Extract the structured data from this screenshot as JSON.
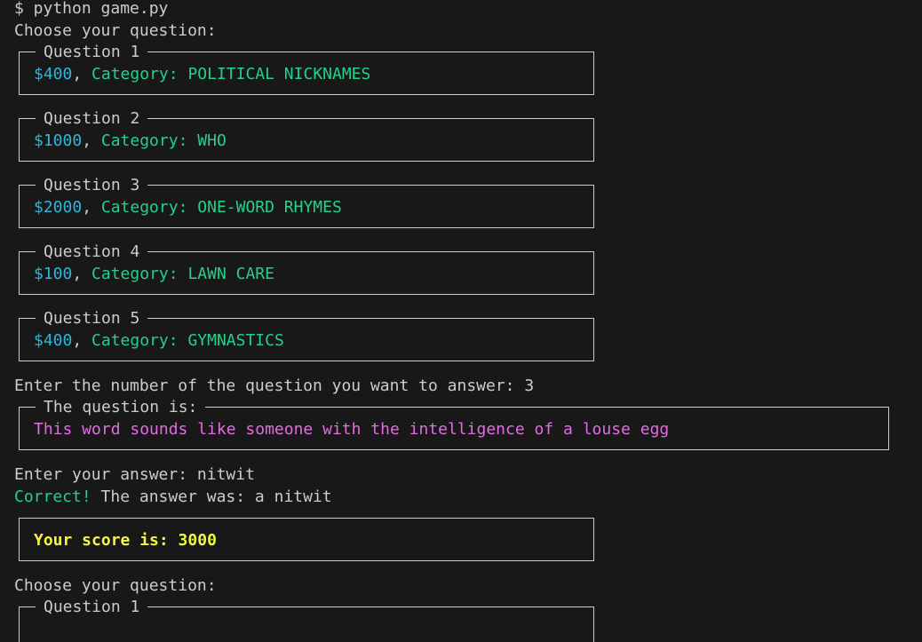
{
  "terminal": {
    "command": "$ python game.py",
    "choose_prompt": "Choose your question:",
    "questions": [
      {
        "title": "Question 1",
        "amount": "$400",
        "category_label": "Category:",
        "category": "POLITICAL NICKNAMES"
      },
      {
        "title": "Question 2",
        "amount": "$1000",
        "category_label": "Category:",
        "category": "WHO"
      },
      {
        "title": "Question 3",
        "amount": "$2000",
        "category_label": "Category:",
        "category": "ONE-WORD RHYMES"
      },
      {
        "title": "Question 4",
        "amount": "$100",
        "category_label": "Category:",
        "category": "LAWN CARE"
      },
      {
        "title": "Question 5",
        "amount": "$400",
        "category_label": "Category:",
        "category": "GYMNASTICS"
      }
    ],
    "number_prompt": "Enter the number of the question you want to answer: 3",
    "question_panel": {
      "title": "The question is:",
      "text": "This word sounds like someone with the intelligence of a louse egg"
    },
    "answer_prompt": "Enter your answer: nitwit",
    "correct_word": "Correct!",
    "answer_was": " The answer was: a nitwit",
    "score_text": "Your score is: 3000",
    "choose_prompt_2": "Choose your question:",
    "next_question_title": "Question 1"
  },
  "colors": {
    "background": "#181818",
    "text": "#cccccc",
    "amount": "#29b8db",
    "category": "#23d18b",
    "question": "#e26ce2",
    "score": "#f5f543",
    "correct": "#23d18b"
  }
}
